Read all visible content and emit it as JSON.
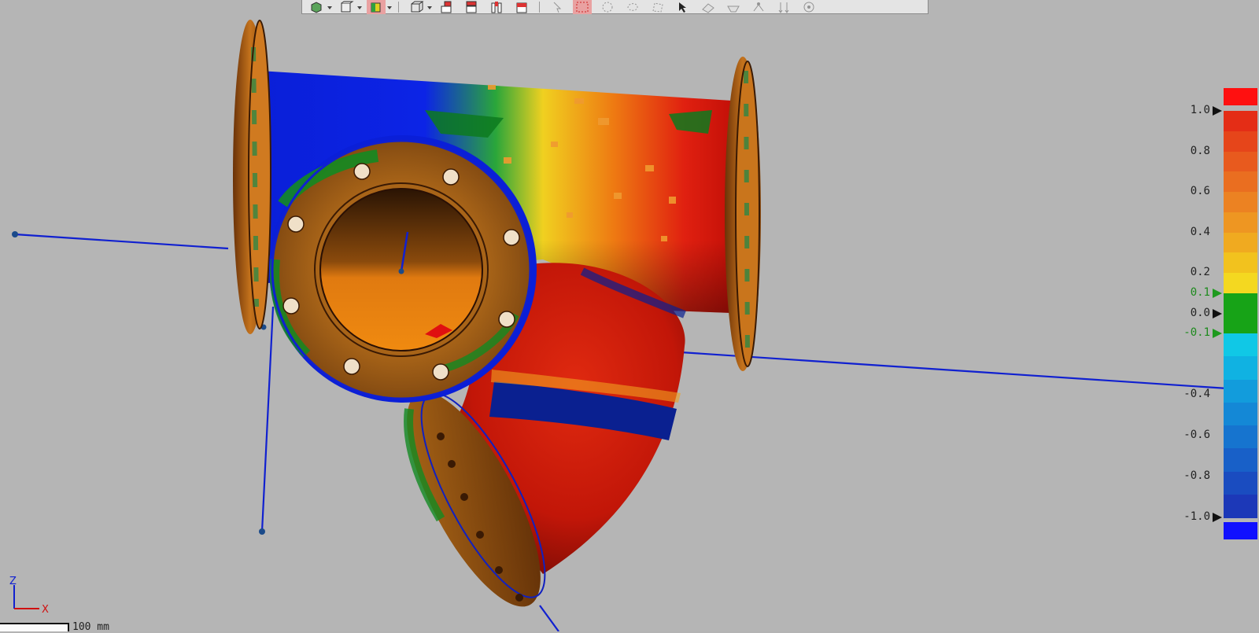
{
  "toolbar": {
    "buttons": [
      {
        "icon": "view-cube-icon",
        "dropdown": true
      },
      {
        "icon": "box-view-icon",
        "dropdown": true
      },
      {
        "icon": "shaded-color-icon",
        "dropdown": true,
        "active": true
      },
      {
        "icon": "wireframe-box-icon",
        "dropdown": true
      },
      {
        "icon": "front-view-icon"
      },
      {
        "icon": "top-view-icon"
      },
      {
        "icon": "side-view-icon"
      },
      {
        "icon": "section-view-icon"
      },
      {
        "icon": "pointer-icon",
        "dim": true
      },
      {
        "icon": "rectangle-select-icon",
        "active": true
      },
      {
        "icon": "circle-select-icon",
        "dim": true
      },
      {
        "icon": "lasso-select-icon",
        "dim": true
      },
      {
        "icon": "polygon-select-icon",
        "dim": true
      },
      {
        "icon": "cursor-select-icon"
      },
      {
        "icon": "surface-select-icon",
        "dim": true
      },
      {
        "icon": "plane-select-icon",
        "dim": true
      },
      {
        "icon": "probe-icon",
        "dim": true
      },
      {
        "icon": "normal-arrows-icon",
        "dim": true
      },
      {
        "icon": "target-icon",
        "dim": true
      }
    ]
  },
  "legend": {
    "labels": [
      {
        "text": "1.0",
        "value": 1.0,
        "arrow": "black"
      },
      {
        "text": "0.8",
        "value": 0.8
      },
      {
        "text": "0.6",
        "value": 0.6
      },
      {
        "text": "0.4",
        "value": 0.4
      },
      {
        "text": "0.2",
        "value": 0.2
      },
      {
        "text": "0.1",
        "value": 0.1,
        "arrow": "green",
        "green": true
      },
      {
        "text": "0.0",
        "value": 0.0,
        "arrow": "black"
      },
      {
        "text": "-0.1",
        "value": -0.1,
        "arrow": "green",
        "green": true
      },
      {
        "text": "-0.4",
        "value": -0.4
      },
      {
        "text": "-0.6",
        "value": -0.6
      },
      {
        "text": "-0.8",
        "value": -0.8
      },
      {
        "text": "-1.0",
        "value": -1.0,
        "arrow": "black"
      }
    ],
    "over_color": "#ff1010",
    "under_color": "#1010ff",
    "tolerance_color": "#17a317",
    "positive_colors": [
      "#e42d16",
      "#e6451a",
      "#e85a1e",
      "#ea6e20",
      "#ec8222",
      "#ee9622",
      "#f0aa20",
      "#f2c21e",
      "#f4d820"
    ],
    "negative_colors": [
      "#10c8e6",
      "#10b2e2",
      "#129cdc",
      "#1488d6",
      "#1674cf",
      "#1860c8",
      "#1a4cc0",
      "#1c38b8"
    ]
  },
  "triad": {
    "z": "Z",
    "x": "X"
  },
  "scale": {
    "label": "100 mm"
  }
}
